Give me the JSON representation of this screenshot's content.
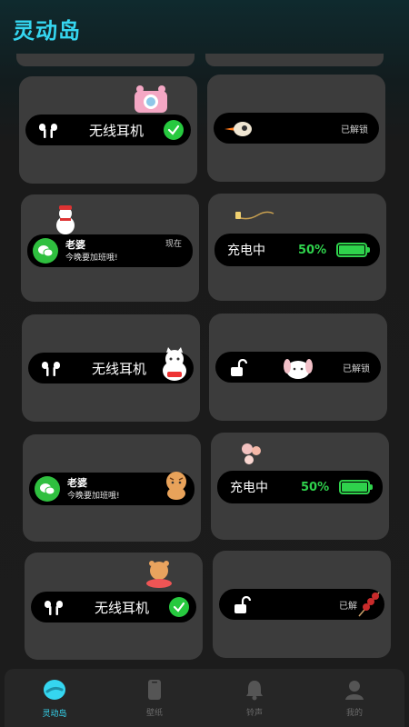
{
  "app": {
    "title": "灵动岛"
  },
  "colors": {
    "accent": "#35d6f0",
    "success": "#27c93f",
    "battery": "#2fd24c",
    "wechat": "#2fbf3f"
  },
  "cards": {
    "earbuds_1": {
      "label": "无线耳机"
    },
    "unlock_1": {
      "label": "已解锁"
    },
    "message_1": {
      "sender": "老婆",
      "text": "今晚要加班哦!",
      "time": "现在"
    },
    "charging_1": {
      "label": "充电中",
      "percent": "50%"
    },
    "earbuds_2": {
      "label": "无线耳机"
    },
    "unlock_2": {
      "label": "已解锁"
    },
    "message_2": {
      "sender": "老婆",
      "text": "今晚要加班哦!"
    },
    "charging_2": {
      "label": "充电中",
      "percent": "50%"
    },
    "earbuds_3": {
      "label": "无线耳机"
    },
    "unlock_3": {
      "label": "已解"
    }
  },
  "tabs": [
    {
      "label": "灵动岛",
      "icon": "island-icon",
      "active": true
    },
    {
      "label": "壁纸",
      "icon": "phone-icon",
      "active": false
    },
    {
      "label": "铃声",
      "icon": "bell-icon",
      "active": false
    },
    {
      "label": "我的",
      "icon": "user-icon",
      "active": false
    }
  ]
}
